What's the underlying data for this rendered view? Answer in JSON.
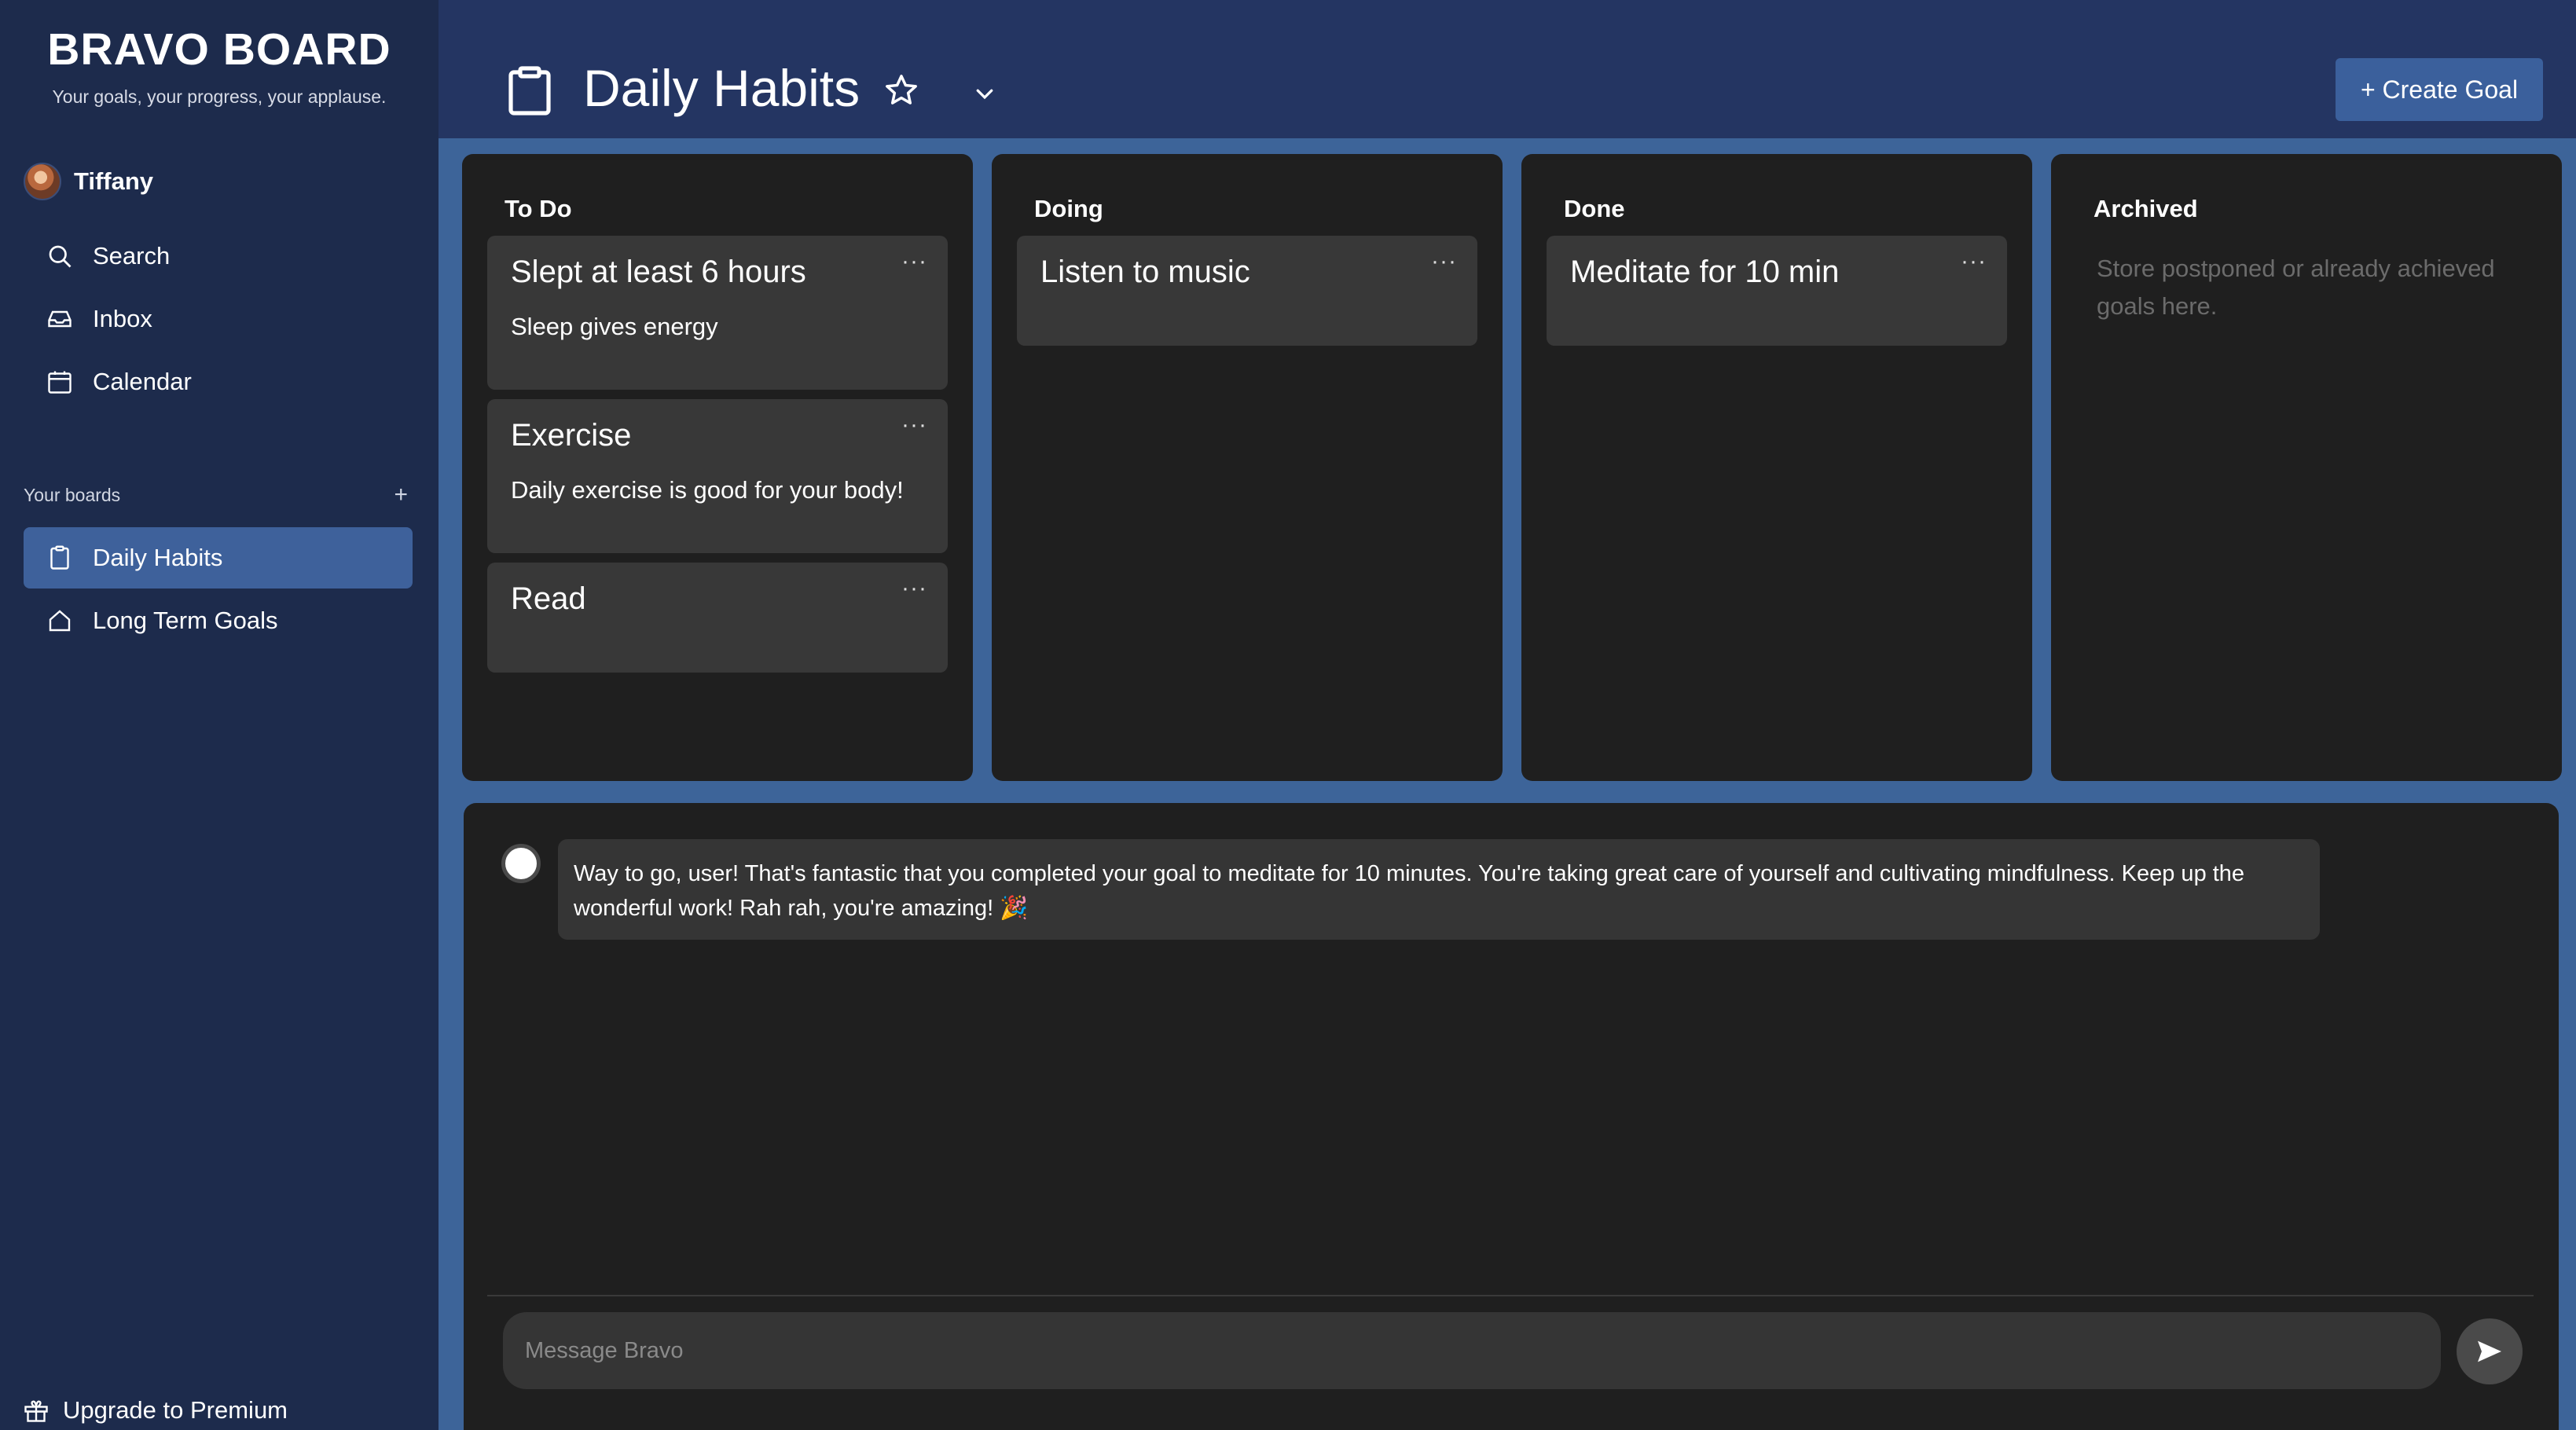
{
  "sidebar": {
    "brand": "BRAVO BOARD",
    "tagline": "Your goals, your progress, your applause.",
    "user_name": "Tiffany",
    "nav": [
      {
        "label": "Search",
        "icon": "search-icon"
      },
      {
        "label": "Inbox",
        "icon": "inbox-icon"
      },
      {
        "label": "Calendar",
        "icon": "calendar-icon"
      }
    ],
    "boards_heading": "Your boards",
    "boards_add": "+",
    "boards": [
      {
        "label": "Daily Habits",
        "icon": "clipboard-icon",
        "active": true
      },
      {
        "label": "Long Term Goals",
        "icon": "home-icon",
        "active": false
      }
    ],
    "upgrade_label": "Upgrade to Premium"
  },
  "header": {
    "board_title": "Daily Habits",
    "create_label": "+ Create Goal"
  },
  "columns": [
    {
      "title": "To Do",
      "cards": [
        {
          "title": "Slept at least 6 hours",
          "description": "Sleep gives energy"
        },
        {
          "title": "Exercise",
          "description": "Daily exercise is good for your body!"
        },
        {
          "title": "Read",
          "description": ""
        }
      ]
    },
    {
      "title": "Doing",
      "cards": [
        {
          "title": "Listen to music",
          "description": ""
        }
      ]
    },
    {
      "title": "Done",
      "cards": [
        {
          "title": "Meditate for 10 min",
          "description": ""
        }
      ]
    },
    {
      "title": "Archived",
      "hint": "Store postponed or already achieved goals here.",
      "cards": []
    }
  ],
  "card_menu": "···",
  "chat": {
    "message": "Way to go, user! That's fantastic that you completed your goal to meditate for 10 minutes. You're taking great care of yourself and cultivating mindfulness. Keep up the wonderful work! Rah rah, you're amazing! 🎉",
    "input_placeholder": "Message Bravo"
  },
  "colors": {
    "header_bg": "#243562",
    "sidebar_bg": "#1d2b4c",
    "main_bg": "#3d6499",
    "column_bg": "#1f1f1f",
    "card_bg": "#383838",
    "accent": "#3b609c"
  }
}
